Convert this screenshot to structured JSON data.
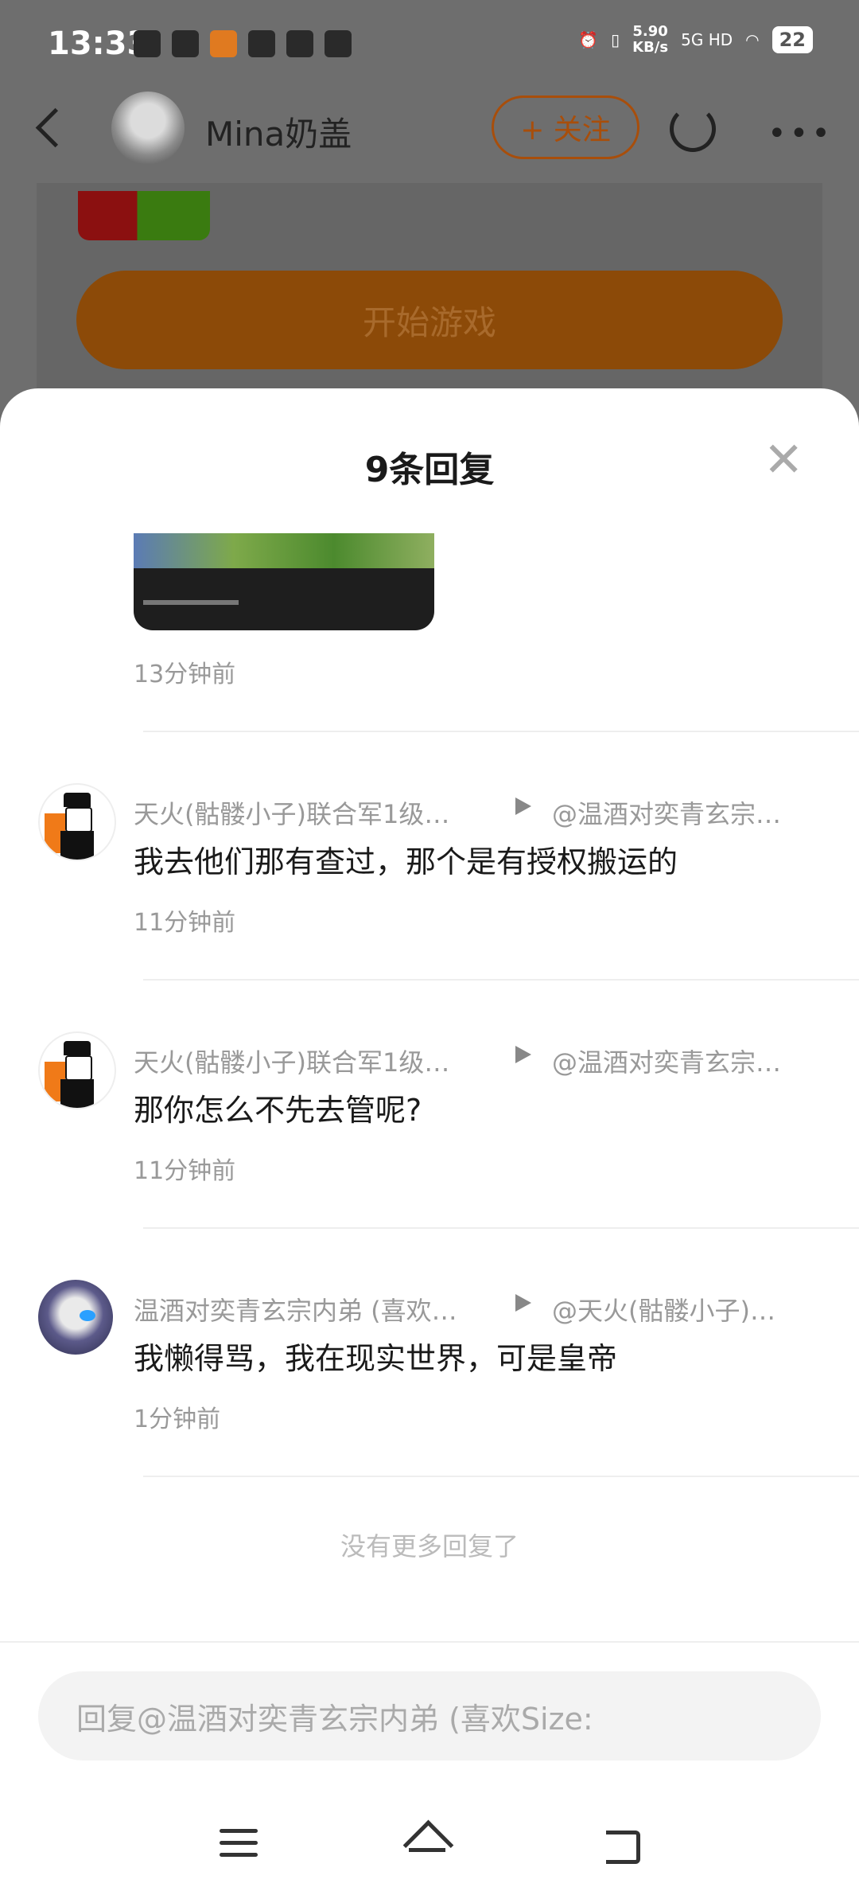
{
  "status_bar": {
    "time": "13:33",
    "net_speed": "5.90",
    "net_unit": "KB/s",
    "net_type": "5G HD",
    "battery": "22"
  },
  "header": {
    "user_name": "Mina奶盖",
    "follow_label": "+ 关注",
    "more_label": "•••"
  },
  "background": {
    "play_button": "开始游戏"
  },
  "sheet": {
    "title": "9条回复",
    "close_label": "✕",
    "first_time": "13分钟前",
    "replies": [
      {
        "user": "天火(骷髅小子)联合军1级…",
        "target": "@温酒对奕青玄宗…",
        "text": "我去他们那有查过，那个是有授权搬运的",
        "time": "11分钟前"
      },
      {
        "user": "天火(骷髅小子)联合军1级…",
        "target": "@温酒对奕青玄宗…",
        "text": "那你怎么不先去管呢?",
        "time": "11分钟前"
      },
      {
        "user": "温酒对奕青玄宗内弟 (喜欢…",
        "target": "@天火(骷髅小子)…",
        "text": "我懒得骂，我在现实世界，可是皇帝",
        "time": "1分钟前"
      }
    ],
    "no_more": "没有更多回复了",
    "input_placeholder": "回复@温酒对奕青玄宗内弟 (喜欢Size:"
  }
}
